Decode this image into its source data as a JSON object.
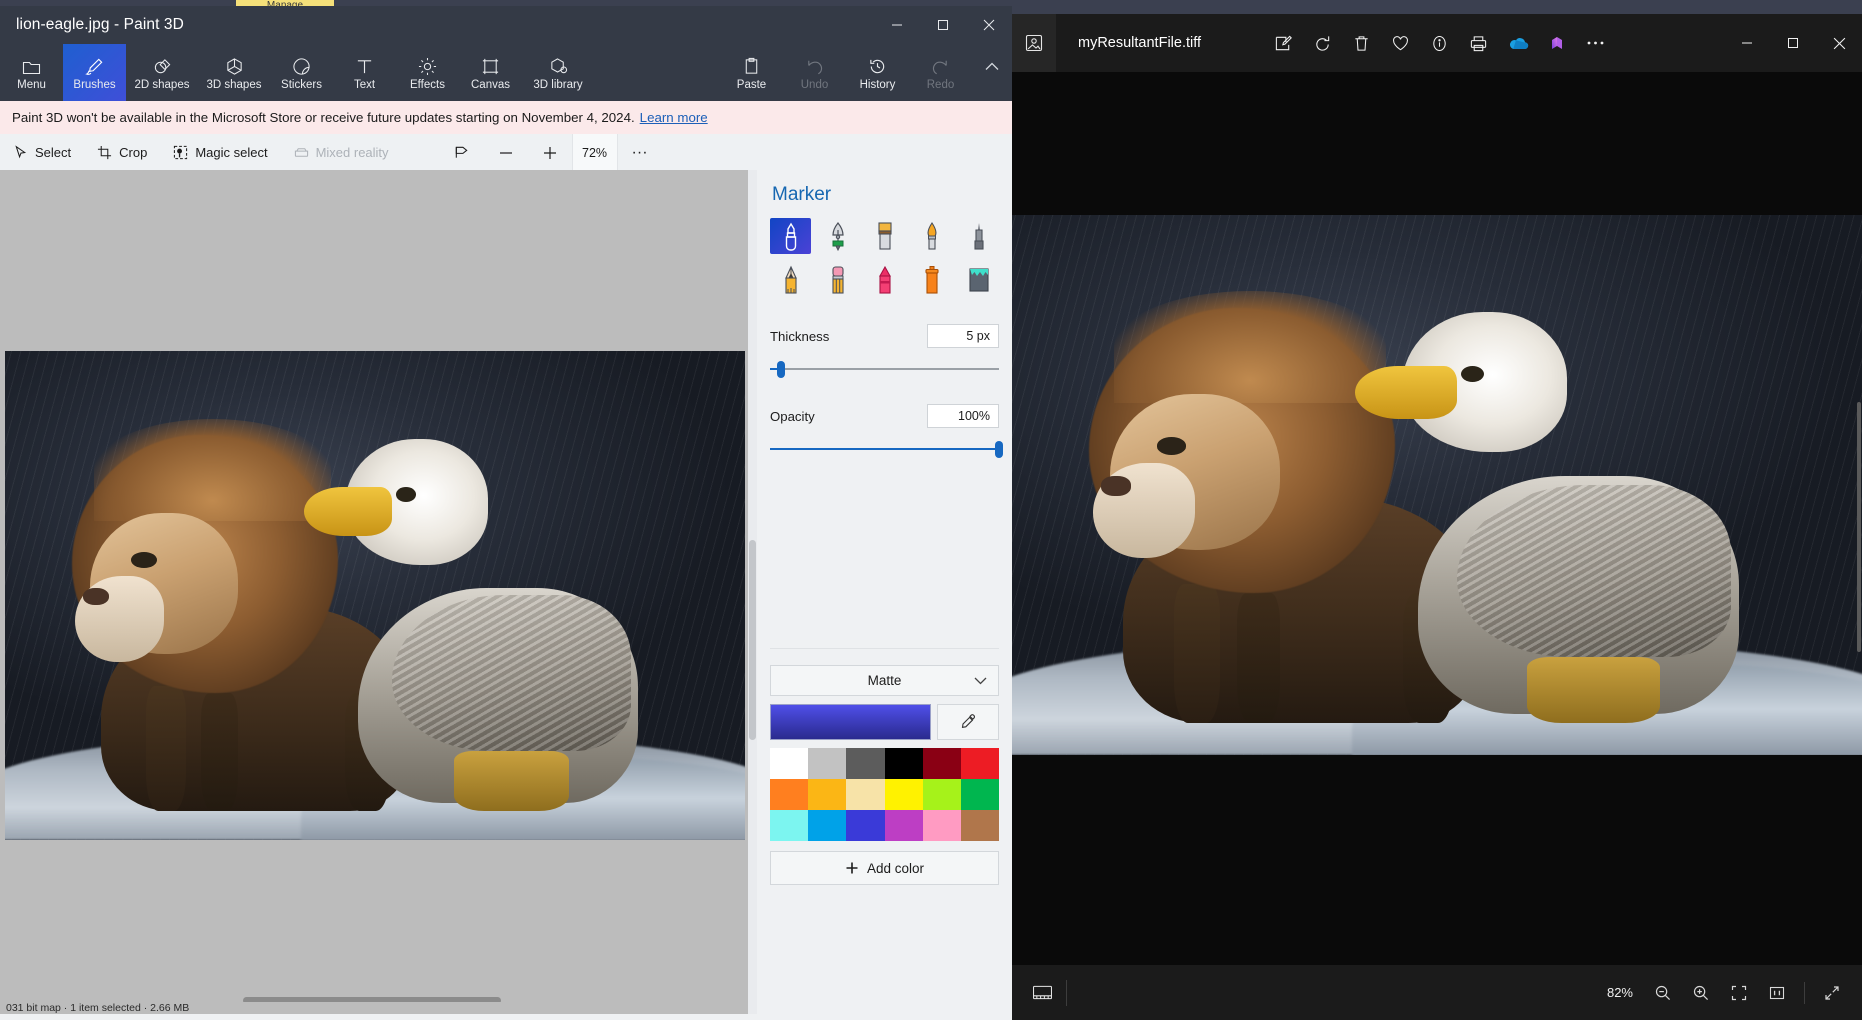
{
  "background": {
    "manage_tab_label": "Manage"
  },
  "paint3d": {
    "title": "lion-eagle.jpg - Paint 3D",
    "window_controls": [
      {
        "name": "minimize",
        "glyph": "—"
      },
      {
        "name": "maximize",
        "glyph": "☐"
      },
      {
        "name": "close",
        "glyph": "✕"
      }
    ],
    "ribbon": [
      {
        "label": "Menu",
        "icon": "folder-icon",
        "state": "normal"
      },
      {
        "label": "Brushes",
        "icon": "brush-icon",
        "state": "active"
      },
      {
        "label": "2D shapes",
        "icon": "2d-shapes-icon",
        "state": "normal"
      },
      {
        "label": "3D shapes",
        "icon": "3d-shapes-icon",
        "state": "normal"
      },
      {
        "label": "Stickers",
        "icon": "stickers-icon",
        "state": "normal"
      },
      {
        "label": "Text",
        "icon": "text-icon",
        "state": "normal"
      },
      {
        "label": "Effects",
        "icon": "effects-icon",
        "state": "normal"
      },
      {
        "label": "Canvas",
        "icon": "canvas-icon",
        "state": "normal"
      },
      {
        "label": "3D library",
        "icon": "3d-library-icon",
        "state": "normal"
      },
      {
        "label": "Paste",
        "icon": "paste-icon",
        "state": "normal"
      },
      {
        "label": "Undo",
        "icon": "undo-icon",
        "state": "disabled"
      },
      {
        "label": "History",
        "icon": "history-icon",
        "state": "normal"
      },
      {
        "label": "Redo",
        "icon": "redo-icon",
        "state": "disabled"
      }
    ],
    "banner": {
      "text": "Paint 3D won't be available in the Microsoft Store or receive future updates starting on November 4, 2024.",
      "link": "Learn more"
    },
    "tools": [
      {
        "label": "Select",
        "icon": "select-cursor-icon",
        "state": "normal"
      },
      {
        "label": "Crop",
        "icon": "crop-icon",
        "state": "normal"
      },
      {
        "label": "Magic select",
        "icon": "magic-select-icon",
        "state": "normal"
      },
      {
        "label": "Mixed reality",
        "icon": "mixed-reality-icon",
        "state": "disabled"
      }
    ],
    "view": {
      "view_3d_icon": "view-3d-icon",
      "zoom_out_label": "—",
      "zoom_in_label": "+",
      "zoom_percent": "72%",
      "more_label": "···"
    },
    "status_bar": "031 bit map · 1 item selected · 2.66 MB",
    "panel": {
      "title": "Marker",
      "brushes": [
        {
          "name": "marker",
          "selected": true
        },
        {
          "name": "calligraphy-pen",
          "selected": false
        },
        {
          "name": "oil-brush",
          "selected": false
        },
        {
          "name": "watercolor",
          "selected": false
        },
        {
          "name": "pixel-pen",
          "selected": false
        },
        {
          "name": "pencil",
          "selected": false
        },
        {
          "name": "eraser",
          "selected": false
        },
        {
          "name": "crayon",
          "selected": false
        },
        {
          "name": "spray-can",
          "selected": false
        },
        {
          "name": "fill",
          "selected": false
        }
      ],
      "thickness": {
        "label": "Thickness",
        "value": "5 px",
        "slider_percent": 5
      },
      "opacity": {
        "label": "Opacity",
        "value": "100%",
        "slider_percent": 100
      },
      "material": {
        "value": "Matte",
        "chevron": "∨"
      },
      "current_color": "#3a3ad8",
      "eyedropper_icon": "eyedropper-icon",
      "swatches": [
        "#ffffff",
        "#c2c2c2",
        "#5c5c5c",
        "#000000",
        "#8a0014",
        "#ed1c24",
        "#ff7f1f",
        "#fbb615",
        "#f7e3a8",
        "#fff200",
        "#a6f21a",
        "#00b64f",
        "#7cf5f0",
        "#00a2e8",
        "#3a3ad8",
        "#bd3ec4",
        "#ff9bc2",
        "#b0764b"
      ],
      "add_color": {
        "label": "Add color",
        "icon": "plus-icon"
      }
    }
  },
  "photos": {
    "app_icon": "photos-app-icon",
    "filename": "myResultantFile.tiff",
    "actions": [
      {
        "name": "edit-image-icon"
      },
      {
        "name": "rotate-icon"
      },
      {
        "name": "delete-icon"
      },
      {
        "name": "favorite-heart-icon"
      },
      {
        "name": "info-icon"
      },
      {
        "name": "print-icon"
      },
      {
        "name": "onedrive-icon"
      },
      {
        "name": "designer-icon"
      },
      {
        "name": "more-options-icon"
      }
    ],
    "window_controls": [
      {
        "name": "minimize",
        "glyph": "—"
      },
      {
        "name": "maximize",
        "glyph": "☐"
      },
      {
        "name": "close",
        "glyph": "✕"
      }
    ],
    "bottom_bar": {
      "filmstrip_icon": "filmstrip-icon",
      "zoom_percent": "82%",
      "zoom_out_icon": "zoom-out-icon",
      "zoom_in_icon": "zoom-in-icon",
      "fit_icon": "fit-to-window-icon",
      "actual_size_icon": "actual-size-1-1-icon",
      "fullscreen_icon": "fullscreen-icon"
    }
  }
}
